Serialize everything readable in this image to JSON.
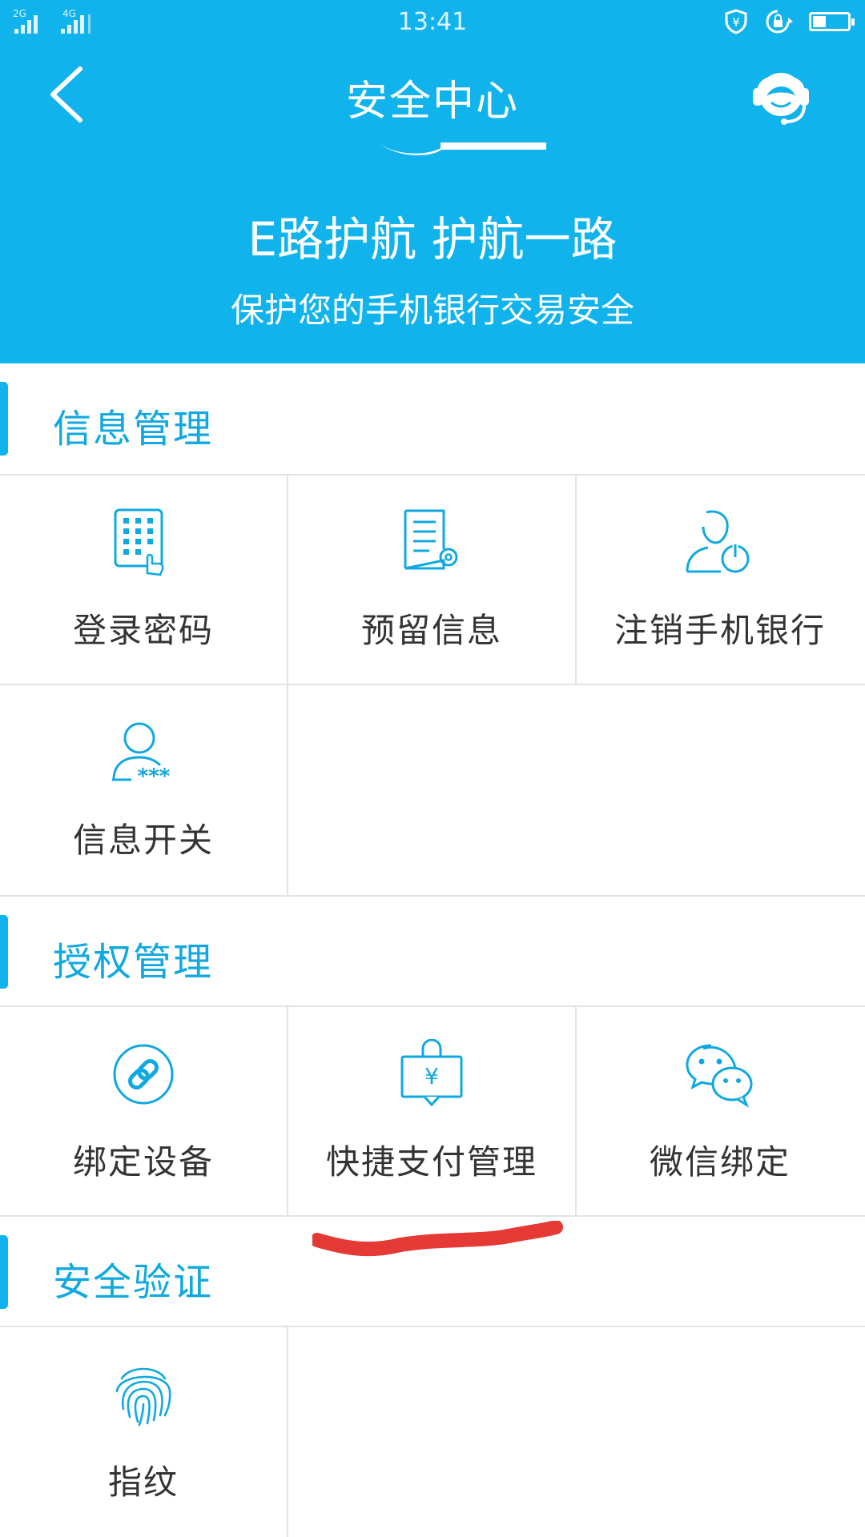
{
  "colors": {
    "primary": "#10b3ec",
    "section_title": "#10a8e0",
    "text": "#333333",
    "divider": "#e3e3e3",
    "annotation_red": "#e53935"
  },
  "status_bar": {
    "network_1": "2G",
    "network_2": "4G",
    "time": "13:41",
    "icons": [
      "yen-shield-icon",
      "rotation-lock-icon",
      "battery-icon"
    ],
    "battery_level": 0.35
  },
  "header": {
    "title": "安全中心",
    "back_icon": "chevron-left-icon",
    "service_icon": "customer-service-icon",
    "slogan": "E路护航 护航一路",
    "subtitle": "保护您的手机银行交易安全"
  },
  "sections": [
    {
      "title": "信息管理",
      "items": [
        {
          "label": "登录密码",
          "icon": "keypad-icon"
        },
        {
          "label": "预留信息",
          "icon": "document-settings-icon"
        },
        {
          "label": "注销手机银行",
          "icon": "user-power-icon"
        },
        {
          "label": "信息开关",
          "icon": "user-masked-icon"
        }
      ]
    },
    {
      "title": "授权管理",
      "items": [
        {
          "label": "绑定设备",
          "icon": "link-icon"
        },
        {
          "label": "快捷支付管理",
          "icon": "yen-bag-icon"
        },
        {
          "label": "微信绑定",
          "icon": "wechat-icon"
        }
      ]
    },
    {
      "title": "安全验证",
      "items": [
        {
          "label": "指纹",
          "icon": "fingerprint-icon"
        }
      ]
    }
  ]
}
